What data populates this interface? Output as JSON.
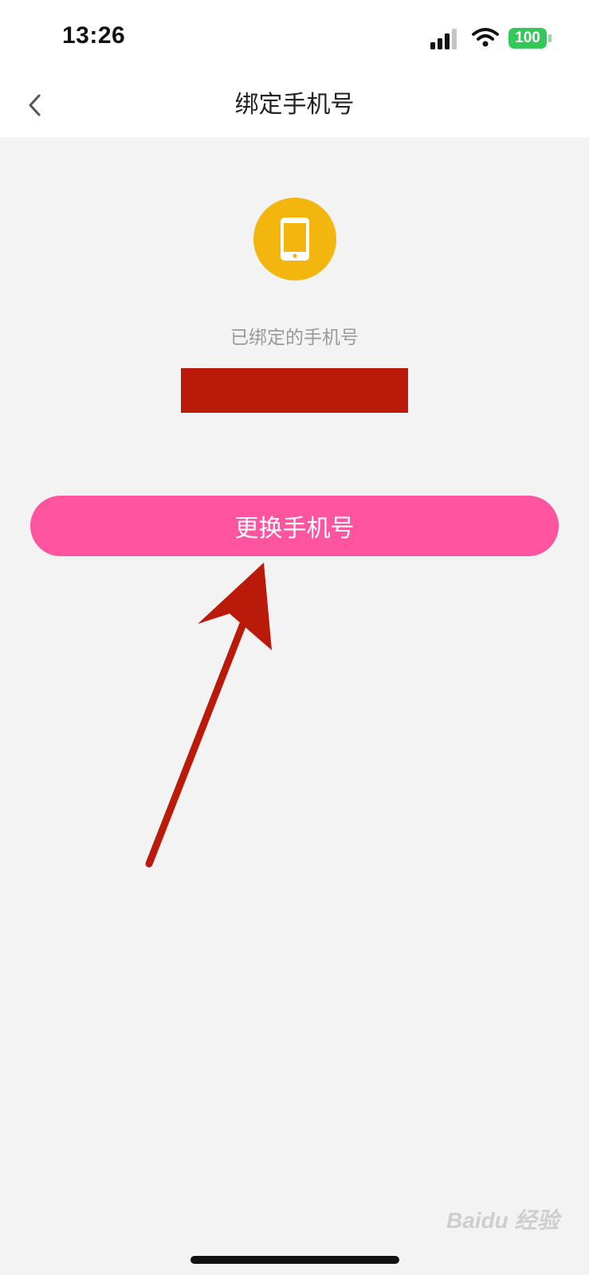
{
  "status_bar": {
    "time": "13:26",
    "battery_level": "100",
    "icons": [
      "cellular-signal-icon",
      "wifi-icon",
      "battery-icon"
    ]
  },
  "nav": {
    "title": "绑定手机号",
    "back_icon": "chevron-left-icon"
  },
  "content": {
    "phone_icon": "mobile-phone-icon",
    "bound_label": "已绑定的手机号",
    "change_button_label": "更换手机号"
  },
  "watermark": {
    "text": "Baidu 经验"
  },
  "colors": {
    "accent": "#ff549f",
    "icon_badge": "#f2b60e",
    "redaction": "#b91a0a",
    "annotation_arrow": "#b91a0a",
    "battery": "#34c759",
    "background": "#f3f3f3"
  }
}
